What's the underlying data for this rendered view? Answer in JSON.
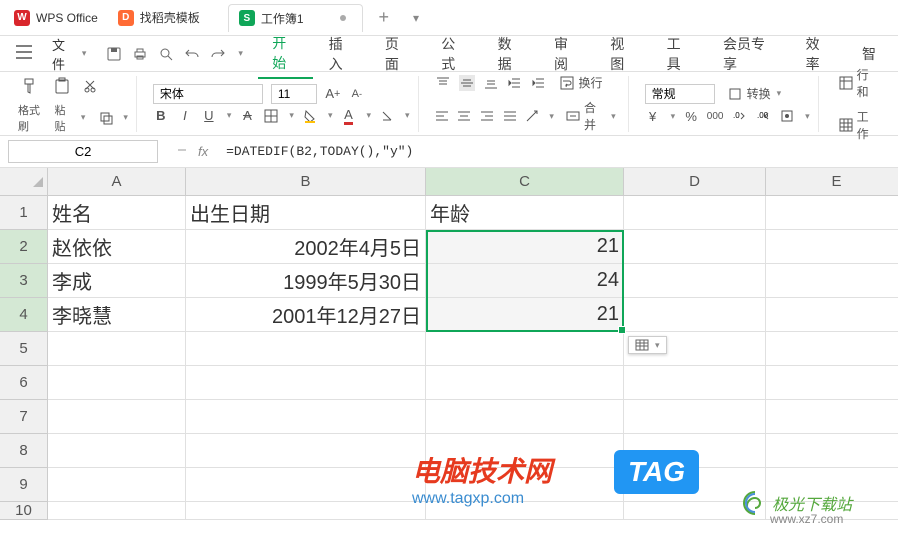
{
  "titlebar": {
    "app_name": "WPS Office",
    "template_tab": "找稻壳模板",
    "workbook_tab": "工作簿1",
    "workbook_badge": "S"
  },
  "menubar": {
    "file": "文件",
    "items": [
      "开始",
      "插入",
      "页面",
      "公式",
      "数据",
      "审阅",
      "视图",
      "工具",
      "会员专享",
      "效率",
      "智"
    ]
  },
  "toolbar": {
    "format_painter": "格式刷",
    "paste": "粘贴",
    "font_name": "宋体",
    "font_size": "11",
    "wrap": "换行",
    "merge": "合并",
    "number_format": "常规",
    "convert": "转换",
    "rows_cols": "行和",
    "worksheet": "工作"
  },
  "formula_bar": {
    "name_box": "C2",
    "fx_label": "fx",
    "formula": "=DATEDIF(B2,TODAY(),\"y\")"
  },
  "columns": [
    "A",
    "B",
    "C",
    "D",
    "E"
  ],
  "row_numbers": [
    "1",
    "2",
    "3",
    "4",
    "5",
    "6",
    "7",
    "8",
    "9",
    "10"
  ],
  "headers": {
    "A": "姓名",
    "B": "出生日期",
    "C": "年龄"
  },
  "data_rows": [
    {
      "name": "赵依依",
      "dob": "2002年4月5日",
      "age": "21"
    },
    {
      "name": "李成",
      "dob": "1999年5月30日",
      "age": "24"
    },
    {
      "name": "李晓慧",
      "dob": "2001年12月27日",
      "age": "21"
    }
  ],
  "watermark": {
    "site1_title": "电脑技术网",
    "site1_url": "www.tagxp.com",
    "tag_text": "TAG",
    "site2_title": "极光下载站",
    "site2_url": "www.xz7.com"
  }
}
